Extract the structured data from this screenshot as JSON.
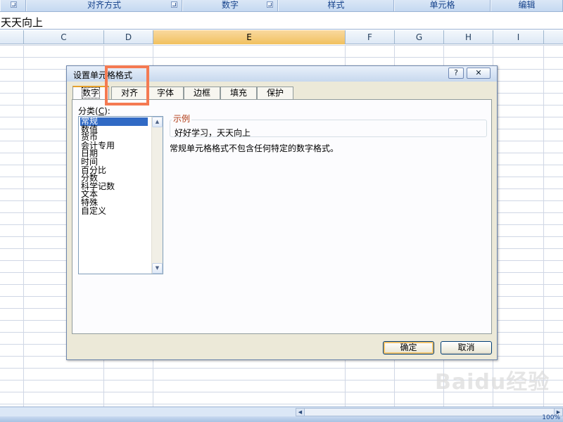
{
  "ribbon": {
    "groups": [
      {
        "label": "对齐方式"
      },
      {
        "label": "数字"
      },
      {
        "label": "样式"
      },
      {
        "label": "单元格"
      },
      {
        "label": "编辑"
      }
    ]
  },
  "formula_bar": {
    "content": "天天向上"
  },
  "grid": {
    "columns": [
      "C",
      "D",
      "E",
      "F",
      "G",
      "H",
      "I"
    ],
    "selected_column": "E"
  },
  "dialog": {
    "title": "设置单元格格式",
    "help_label": "?",
    "close_label": "✕",
    "tabs": [
      "数字",
      "对齐",
      "字体",
      "边框",
      "填充",
      "保护"
    ],
    "active_tab": "数字",
    "category_label": "分类",
    "category_hotkey": "C",
    "category_suffix": ":",
    "categories": [
      "常规",
      "数值",
      "货币",
      "会计专用",
      "日期",
      "时间",
      "百分比",
      "分数",
      "科学记数",
      "文本",
      "特殊",
      "自定义"
    ],
    "selected_category": "常规",
    "sample_label": "示例",
    "sample_value": "好好学习，天天向上",
    "description": "常规单元格格式不包含任何特定的数字格式。",
    "ok_label": "确定",
    "cancel_label": "取消"
  },
  "status": {
    "zoom_readout": "100%"
  },
  "watermark": {
    "text": "Baidu经验"
  },
  "colors": {
    "highlight": "#f47a52",
    "selection": "#316ac5",
    "selected_column_header": "#f1c15f",
    "ribbon_text": "#15428b"
  }
}
